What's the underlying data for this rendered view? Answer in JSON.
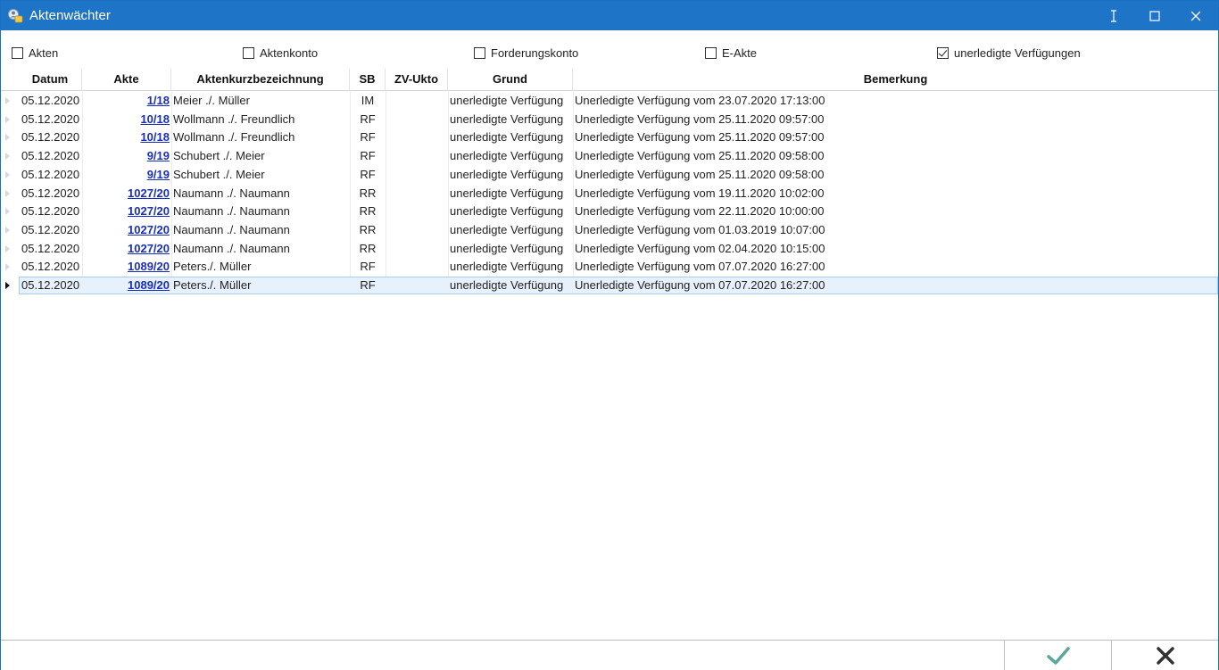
{
  "window": {
    "title": "Aktenwächter",
    "accent_color": "#1e74c6"
  },
  "filters": [
    {
      "label": "Akten",
      "checked": false
    },
    {
      "label": "Aktenkonto",
      "checked": false
    },
    {
      "label": "Forderungskonto",
      "checked": false
    },
    {
      "label": "E-Akte",
      "checked": false
    },
    {
      "label": "unerledigte Verfügungen",
      "checked": true
    }
  ],
  "table": {
    "columns": [
      "Datum",
      "Akte",
      "Aktenkurzbezeichnung",
      "SB",
      "ZV-Ukto",
      "Grund",
      "Bemerkung"
    ],
    "rows": [
      {
        "datum": "05.12.2020",
        "akte": "1/18",
        "bez": "Meier ./. Müller",
        "sb": "IM",
        "zv": "",
        "grund": "unerledigte Verfügung",
        "bem": "Unerledigte Verfügung vom 23.07.2020 17:13:00"
      },
      {
        "datum": "05.12.2020",
        "akte": "10/18",
        "bez": "Wollmann ./. Freundlich",
        "sb": "RF",
        "zv": "",
        "grund": "unerledigte Verfügung",
        "bem": "Unerledigte Verfügung vom 25.11.2020 09:57:00"
      },
      {
        "datum": "05.12.2020",
        "akte": "10/18",
        "bez": "Wollmann ./. Freundlich",
        "sb": "RF",
        "zv": "",
        "grund": "unerledigte Verfügung",
        "bem": "Unerledigte Verfügung vom 25.11.2020 09:57:00"
      },
      {
        "datum": "05.12.2020",
        "akte": "9/19",
        "bez": "Schubert ./. Meier",
        "sb": "RF",
        "zv": "",
        "grund": "unerledigte Verfügung",
        "bem": "Unerledigte Verfügung vom 25.11.2020 09:58:00"
      },
      {
        "datum": "05.12.2020",
        "akte": "9/19",
        "bez": "Schubert ./. Meier",
        "sb": "RF",
        "zv": "",
        "grund": "unerledigte Verfügung",
        "bem": "Unerledigte Verfügung vom 25.11.2020 09:58:00"
      },
      {
        "datum": "05.12.2020",
        "akte": "1027/20",
        "bez": "Naumann ./. Naumann",
        "sb": "RR",
        "zv": "",
        "grund": "unerledigte Verfügung",
        "bem": "Unerledigte Verfügung vom 19.11.2020 10:02:00"
      },
      {
        "datum": "05.12.2020",
        "akte": "1027/20",
        "bez": "Naumann ./. Naumann",
        "sb": "RR",
        "zv": "",
        "grund": "unerledigte Verfügung",
        "bem": "Unerledigte Verfügung vom 22.11.2020 10:00:00"
      },
      {
        "datum": "05.12.2020",
        "akte": "1027/20",
        "bez": "Naumann ./. Naumann",
        "sb": "RR",
        "zv": "",
        "grund": "unerledigte Verfügung",
        "bem": "Unerledigte Verfügung vom 01.03.2019 10:07:00"
      },
      {
        "datum": "05.12.2020",
        "akte": "1027/20",
        "bez": "Naumann ./. Naumann",
        "sb": "RR",
        "zv": "",
        "grund": "unerledigte Verfügung",
        "bem": "Unerledigte Verfügung vom 02.04.2020 10:15:00"
      },
      {
        "datum": "05.12.2020",
        "akte": "1089/20",
        "bez": "Peters./. Müller",
        "sb": "RF",
        "zv": "",
        "grund": "unerledigte Verfügung",
        "bem": "Unerledigte Verfügung vom 07.07.2020 16:27:00"
      },
      {
        "datum": "05.12.2020",
        "akte": "1089/20",
        "bez": "Peters./. Müller",
        "sb": "RF",
        "zv": "",
        "grund": "unerledigte Verfügung",
        "bem": "Unerledigte Verfügung vom 07.07.2020 16:27:00"
      }
    ],
    "selected_row": 10
  },
  "footer": {
    "ok_icon": "checkmark-icon",
    "ok_color": "#5aa89a",
    "cancel_icon": "x-icon",
    "cancel_color": "#333333"
  }
}
